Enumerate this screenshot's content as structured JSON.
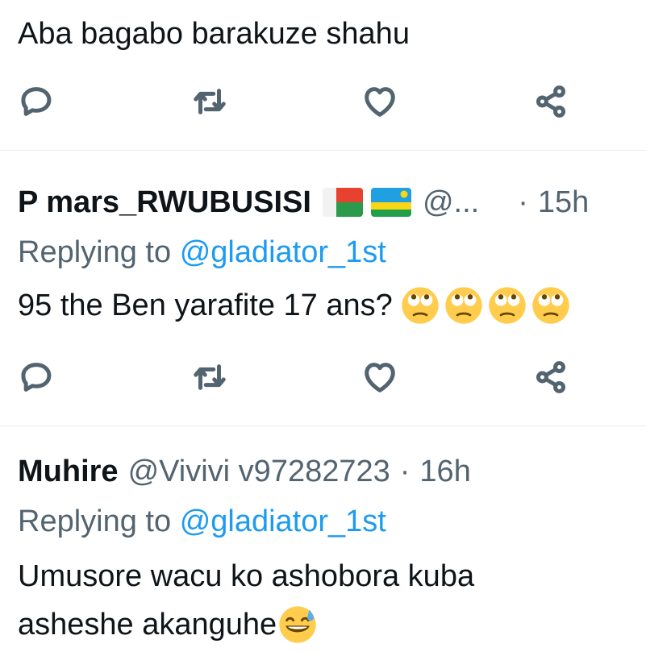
{
  "tweets": [
    {
      "text": "Aba bagabo barakuze shahu"
    },
    {
      "display_name": "P mars_RWUBUSISI",
      "handle": "@...",
      "dot": "·",
      "time": "15h",
      "replying_label": "Replying to",
      "replying_mention": "@gladiator_1st",
      "text": "95 the Ben yarafite 17 ans?",
      "flags": [
        "madagascar-flag-icon",
        "rwanda-flag-icon"
      ],
      "emojis": [
        "face-with-rolling-eyes-icon",
        "face-with-rolling-eyes-icon",
        "face-with-rolling-eyes-icon",
        "face-with-rolling-eyes-icon"
      ]
    },
    {
      "display_name": "Muhire",
      "handle": "@Vivivi v97282723",
      "dot": "·",
      "time": "16h",
      "replying_label": "Replying to",
      "replying_mention": "@gladiator_1st",
      "text_line1": "Umusore wacu ko ashobora kuba",
      "text_line2": "asheshe akanguhe",
      "emojis": [
        "grinning-face-with-sweat-icon"
      ]
    }
  ],
  "actions": [
    "reply-icon",
    "retweet-icon",
    "like-icon",
    "share-icon"
  ],
  "colors": {
    "text": "#0f1419",
    "secondary": "#536471",
    "mention": "#1d9bf0",
    "divider": "#e6ecf0"
  }
}
